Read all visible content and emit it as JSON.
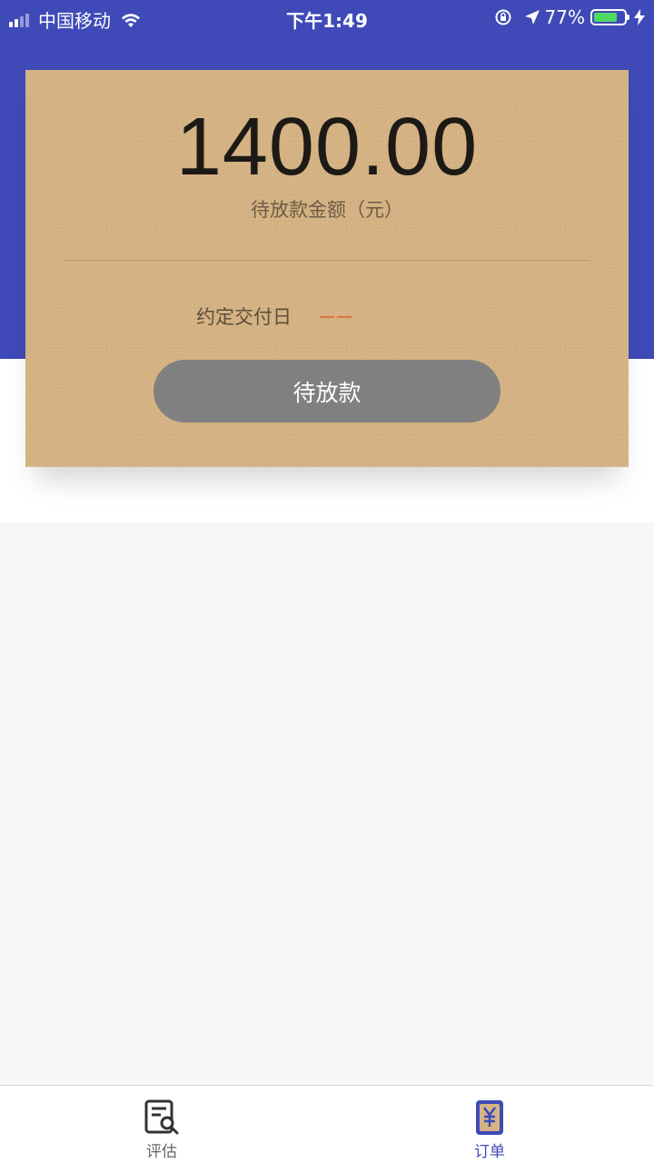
{
  "status_bar": {
    "carrier": "中国移动",
    "time": "下午1:49",
    "battery_percent": "77%",
    "battery_level": 0.77
  },
  "card": {
    "amount": "1400.00",
    "amount_label": "待放款金额（元）",
    "delivery_label": "约定交付日",
    "delivery_value": "——",
    "button_label": "待放款"
  },
  "tab_bar": {
    "items": [
      {
        "label": "评估",
        "icon": "search-document-icon",
        "active": false
      },
      {
        "label": "订单",
        "icon": "yuan-order-icon",
        "active": true
      }
    ]
  },
  "colors": {
    "primary": "#3f4ab8",
    "card_bg": "#d5b384",
    "button_bg": "#808080",
    "accent_orange": "#e0531f"
  }
}
